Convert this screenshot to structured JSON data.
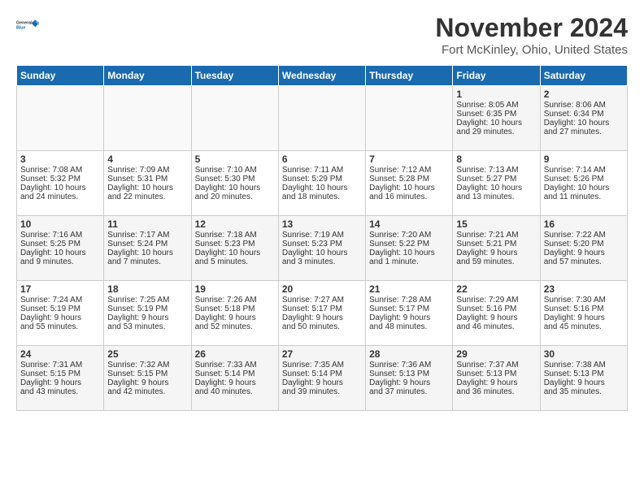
{
  "logo": {
    "line1": "General",
    "line2": "Blue"
  },
  "title": "November 2024",
  "location": "Fort McKinley, Ohio, United States",
  "weekdays": [
    "Sunday",
    "Monday",
    "Tuesday",
    "Wednesday",
    "Thursday",
    "Friday",
    "Saturday"
  ],
  "weeks": [
    [
      {
        "day": "",
        "info": ""
      },
      {
        "day": "",
        "info": ""
      },
      {
        "day": "",
        "info": ""
      },
      {
        "day": "",
        "info": ""
      },
      {
        "day": "",
        "info": ""
      },
      {
        "day": "1",
        "info": "Sunrise: 8:05 AM\nSunset: 6:35 PM\nDaylight: 10 hours\nand 29 minutes."
      },
      {
        "day": "2",
        "info": "Sunrise: 8:06 AM\nSunset: 6:34 PM\nDaylight: 10 hours\nand 27 minutes."
      }
    ],
    [
      {
        "day": "3",
        "info": "Sunrise: 7:08 AM\nSunset: 5:32 PM\nDaylight: 10 hours\nand 24 minutes."
      },
      {
        "day": "4",
        "info": "Sunrise: 7:09 AM\nSunset: 5:31 PM\nDaylight: 10 hours\nand 22 minutes."
      },
      {
        "day": "5",
        "info": "Sunrise: 7:10 AM\nSunset: 5:30 PM\nDaylight: 10 hours\nand 20 minutes."
      },
      {
        "day": "6",
        "info": "Sunrise: 7:11 AM\nSunset: 5:29 PM\nDaylight: 10 hours\nand 18 minutes."
      },
      {
        "day": "7",
        "info": "Sunrise: 7:12 AM\nSunset: 5:28 PM\nDaylight: 10 hours\nand 16 minutes."
      },
      {
        "day": "8",
        "info": "Sunrise: 7:13 AM\nSunset: 5:27 PM\nDaylight: 10 hours\nand 13 minutes."
      },
      {
        "day": "9",
        "info": "Sunrise: 7:14 AM\nSunset: 5:26 PM\nDaylight: 10 hours\nand 11 minutes."
      }
    ],
    [
      {
        "day": "10",
        "info": "Sunrise: 7:16 AM\nSunset: 5:25 PM\nDaylight: 10 hours\nand 9 minutes."
      },
      {
        "day": "11",
        "info": "Sunrise: 7:17 AM\nSunset: 5:24 PM\nDaylight: 10 hours\nand 7 minutes."
      },
      {
        "day": "12",
        "info": "Sunrise: 7:18 AM\nSunset: 5:23 PM\nDaylight: 10 hours\nand 5 minutes."
      },
      {
        "day": "13",
        "info": "Sunrise: 7:19 AM\nSunset: 5:23 PM\nDaylight: 10 hours\nand 3 minutes."
      },
      {
        "day": "14",
        "info": "Sunrise: 7:20 AM\nSunset: 5:22 PM\nDaylight: 10 hours\nand 1 minute."
      },
      {
        "day": "15",
        "info": "Sunrise: 7:21 AM\nSunset: 5:21 PM\nDaylight: 9 hours\nand 59 minutes."
      },
      {
        "day": "16",
        "info": "Sunrise: 7:22 AM\nSunset: 5:20 PM\nDaylight: 9 hours\nand 57 minutes."
      }
    ],
    [
      {
        "day": "17",
        "info": "Sunrise: 7:24 AM\nSunset: 5:19 PM\nDaylight: 9 hours\nand 55 minutes."
      },
      {
        "day": "18",
        "info": "Sunrise: 7:25 AM\nSunset: 5:19 PM\nDaylight: 9 hours\nand 53 minutes."
      },
      {
        "day": "19",
        "info": "Sunrise: 7:26 AM\nSunset: 5:18 PM\nDaylight: 9 hours\nand 52 minutes."
      },
      {
        "day": "20",
        "info": "Sunrise: 7:27 AM\nSunset: 5:17 PM\nDaylight: 9 hours\nand 50 minutes."
      },
      {
        "day": "21",
        "info": "Sunrise: 7:28 AM\nSunset: 5:17 PM\nDaylight: 9 hours\nand 48 minutes."
      },
      {
        "day": "22",
        "info": "Sunrise: 7:29 AM\nSunset: 5:16 PM\nDaylight: 9 hours\nand 46 minutes."
      },
      {
        "day": "23",
        "info": "Sunrise: 7:30 AM\nSunset: 5:16 PM\nDaylight: 9 hours\nand 45 minutes."
      }
    ],
    [
      {
        "day": "24",
        "info": "Sunrise: 7:31 AM\nSunset: 5:15 PM\nDaylight: 9 hours\nand 43 minutes."
      },
      {
        "day": "25",
        "info": "Sunrise: 7:32 AM\nSunset: 5:15 PM\nDaylight: 9 hours\nand 42 minutes."
      },
      {
        "day": "26",
        "info": "Sunrise: 7:33 AM\nSunset: 5:14 PM\nDaylight: 9 hours\nand 40 minutes."
      },
      {
        "day": "27",
        "info": "Sunrise: 7:35 AM\nSunset: 5:14 PM\nDaylight: 9 hours\nand 39 minutes."
      },
      {
        "day": "28",
        "info": "Sunrise: 7:36 AM\nSunset: 5:13 PM\nDaylight: 9 hours\nand 37 minutes."
      },
      {
        "day": "29",
        "info": "Sunrise: 7:37 AM\nSunset: 5:13 PM\nDaylight: 9 hours\nand 36 minutes."
      },
      {
        "day": "30",
        "info": "Sunrise: 7:38 AM\nSunset: 5:13 PM\nDaylight: 9 hours\nand 35 minutes."
      }
    ]
  ]
}
